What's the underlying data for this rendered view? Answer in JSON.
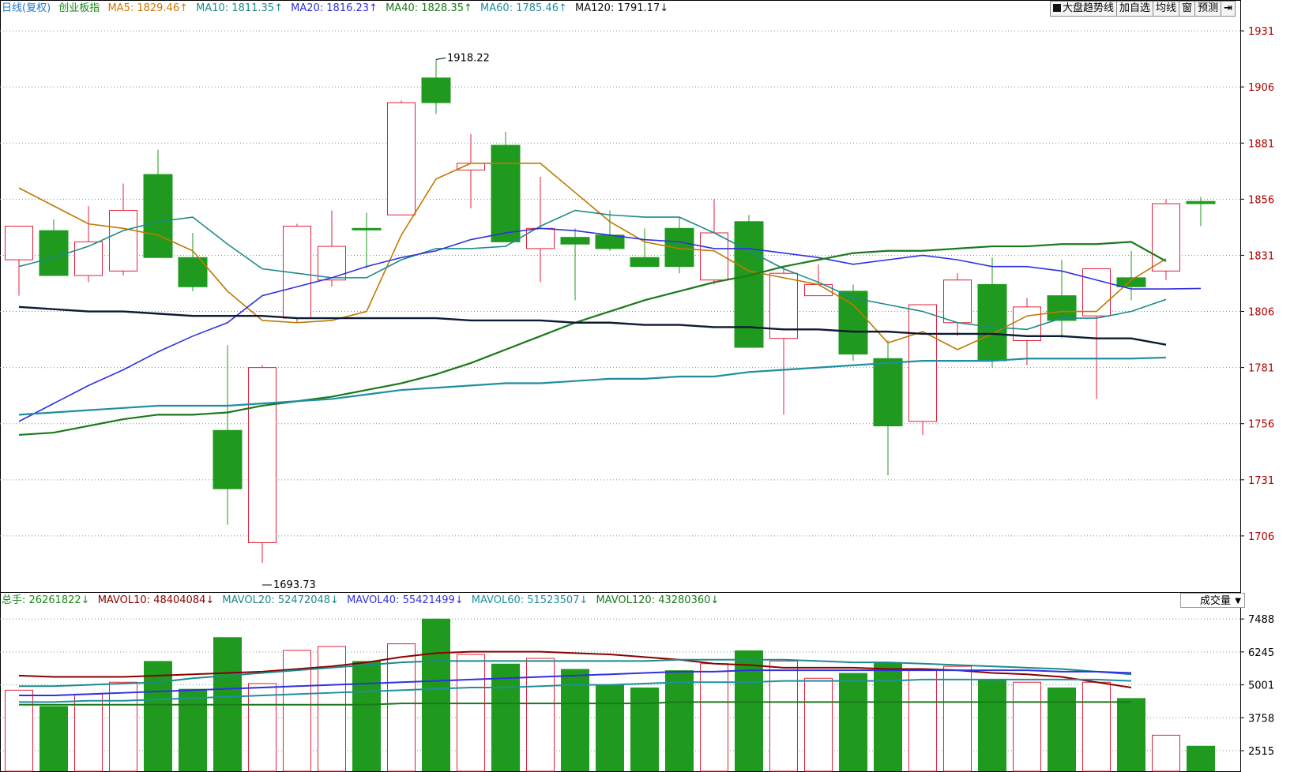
{
  "header": {
    "period_label": "日线(复权)",
    "index_name": "创业板指",
    "ma_values": [
      {
        "label": "MA5: 1829.46↑",
        "color": "#d17600"
      },
      {
        "label": "MA10: 1811.35↑",
        "color": "#1e8a8a"
      },
      {
        "label": "MA20: 1816.23↑",
        "color": "#3030e0"
      },
      {
        "label": "MA40: 1828.35↑",
        "color": "#1a7a1a"
      },
      {
        "label": "MA60: 1785.46↑",
        "color": "#1e8fa0"
      },
      {
        "label": "MA120: 1791.17↓",
        "color": "#111111"
      }
    ]
  },
  "toolbar": {
    "trend_label": "大盘趋势线",
    "add_fav_label": "加自选",
    "avg_line_label": "均线",
    "window_label": "窗",
    "forecast_label": "预测",
    "exit_icon": "exit-arrow-icon"
  },
  "volume_header": {
    "total_label": "总手: 26261822↓",
    "items": [
      {
        "label": "MAVOL10: 48404084↓",
        "color": "#8b0000"
      },
      {
        "label": "MAVOL20: 52472048↓",
        "color": "#1e8a8a"
      },
      {
        "label": "MAVOL40: 55421499↓",
        "color": "#3030e0"
      },
      {
        "label": "MAVOL60: 51523507↓",
        "color": "#1e8fa0"
      },
      {
        "label": "MAVOL120: 43280360↓",
        "color": "#1a7a1a"
      }
    ],
    "selector_value": "成交量"
  },
  "colors": {
    "up": "#e0203a",
    "down": "#1f9a1f",
    "grid": "#5aa0a0",
    "axis_text": "#b00000"
  },
  "chart_data": [
    {
      "type": "candlestick",
      "price_range": [
        1681,
        1937
      ],
      "y_ticks": [
        1931,
        1906,
        1881,
        1856,
        1831,
        1806,
        1781,
        1756,
        1731,
        1706
      ],
      "annotations": [
        {
          "text": "1918.22",
          "index": 12
        },
        {
          "text": "1693.73",
          "index": 7
        }
      ],
      "candles": [
        {
          "o": 1829,
          "h": 1836,
          "l": 1813,
          "c": 1844,
          "up": true
        },
        {
          "o": 1842,
          "h": 1847,
          "l": 1823,
          "c": 1822,
          "up": false
        },
        {
          "o": 1822,
          "h": 1853,
          "l": 1819,
          "c": 1837,
          "up": true
        },
        {
          "o": 1824,
          "h": 1863,
          "l": 1822,
          "c": 1851,
          "up": true
        },
        {
          "o": 1867,
          "h": 1878,
          "l": 1830,
          "c": 1830,
          "up": false
        },
        {
          "o": 1830,
          "h": 1841,
          "l": 1815,
          "c": 1817,
          "up": false
        },
        {
          "o": 1753,
          "h": 1791,
          "l": 1711,
          "c": 1727,
          "up": false
        },
        {
          "o": 1703,
          "h": 1782,
          "l": 1694,
          "c": 1781,
          "up": true
        },
        {
          "o": 1803,
          "h": 1845,
          "l": 1801,
          "c": 1844,
          "up": true
        },
        {
          "o": 1820,
          "h": 1851,
          "l": 1817,
          "c": 1835,
          "up": true
        },
        {
          "o": 1843,
          "h": 1850,
          "l": 1825,
          "c": 1843,
          "up": false
        },
        {
          "o": 1849,
          "h": 1900,
          "l": 1849,
          "c": 1899,
          "up": true
        },
        {
          "o": 1910,
          "h": 1918.22,
          "l": 1894,
          "c": 1899,
          "up": false
        },
        {
          "o": 1869,
          "h": 1885,
          "l": 1852,
          "c": 1872,
          "up": true
        },
        {
          "o": 1880,
          "h": 1886,
          "l": 1837,
          "c": 1837,
          "up": false
        },
        {
          "o": 1834,
          "h": 1866,
          "l": 1819,
          "c": 1843,
          "up": true
        },
        {
          "o": 1839,
          "h": 1843,
          "l": 1811,
          "c": 1836,
          "up": false
        },
        {
          "o": 1840,
          "h": 1851,
          "l": 1833,
          "c": 1834,
          "up": false
        },
        {
          "o": 1830,
          "h": 1843,
          "l": 1826,
          "c": 1826,
          "up": false
        },
        {
          "o": 1843,
          "h": 1848,
          "l": 1823,
          "c": 1826,
          "up": false
        },
        {
          "o": 1820,
          "h": 1856,
          "l": 1818,
          "c": 1841,
          "up": true
        },
        {
          "o": 1846,
          "h": 1849,
          "l": 1790,
          "c": 1790,
          "up": false
        },
        {
          "o": 1794,
          "h": 1826,
          "l": 1760,
          "c": 1823,
          "up": true
        },
        {
          "o": 1813,
          "h": 1827,
          "l": 1814,
          "c": 1818,
          "up": true
        },
        {
          "o": 1815,
          "h": 1818,
          "l": 1784,
          "c": 1787,
          "up": false
        },
        {
          "o": 1785,
          "h": 1793,
          "l": 1733,
          "c": 1755,
          "up": false
        },
        {
          "o": 1757,
          "h": 1809,
          "l": 1751,
          "c": 1809,
          "up": true
        },
        {
          "o": 1801,
          "h": 1823,
          "l": 1795,
          "c": 1820,
          "up": true
        },
        {
          "o": 1818,
          "h": 1830,
          "l": 1781,
          "c": 1784,
          "up": false
        },
        {
          "o": 1793,
          "h": 1812,
          "l": 1782,
          "c": 1808,
          "up": true
        },
        {
          "o": 1813,
          "h": 1829,
          "l": 1794,
          "c": 1802,
          "up": false
        },
        {
          "o": 1804,
          "h": 1823,
          "l": 1767,
          "c": 1825,
          "up": true
        },
        {
          "o": 1821,
          "h": 1833,
          "l": 1811,
          "c": 1817,
          "up": false
        },
        {
          "o": 1824,
          "h": 1856,
          "l": 1820,
          "c": 1854,
          "up": true
        },
        {
          "o": 1854,
          "h": 1857,
          "l": 1844,
          "c": 1855,
          "up": false
        }
      ],
      "moving_averages": [
        {
          "name": "MA5",
          "color": "#c07800",
          "width": 1.6,
          "values": [
            1861,
            1853,
            1845,
            1843,
            1840,
            1833,
            1815,
            1802,
            1801,
            1802,
            1806,
            1840,
            1865,
            1872,
            1872,
            1872,
            1859,
            1846,
            1837,
            1834,
            1833,
            1824,
            1821,
            1818,
            1809,
            1792,
            1797,
            1789,
            1796,
            1804,
            1806,
            1806,
            1820,
            1829.46
          ]
        },
        {
          "name": "MA10",
          "color": "#1e8a8a",
          "width": 1.6,
          "values": [
            1826,
            1830,
            1835,
            1842,
            1846,
            1848,
            1836,
            1825,
            1823,
            1821,
            1821,
            1829,
            1834,
            1834,
            1835,
            1844,
            1851,
            1849,
            1848,
            1848,
            1841,
            1833,
            1825,
            1819,
            1812,
            1809,
            1806,
            1801,
            1799,
            1798,
            1803,
            1803,
            1806,
            1811.35
          ]
        },
        {
          "name": "MA20",
          "color": "#3030e0",
          "width": 1.6,
          "values": [
            1757,
            1765,
            1773,
            1780,
            1788,
            1795,
            1801,
            1813,
            1817,
            1821,
            1826,
            1830,
            1833,
            1838,
            1841,
            1843,
            1842,
            1840,
            1838,
            1837,
            1834,
            1834,
            1832,
            1830,
            1827,
            1829,
            1831,
            1829,
            1826,
            1826,
            1824,
            1820,
            1816,
            1816,
            1816.23
          ]
        },
        {
          "name": "MA40",
          "color": "#1a7a1a",
          "width": 2.2,
          "values": [
            1751,
            1752,
            1755,
            1758,
            1760,
            1760,
            1761,
            1764,
            1766,
            1768,
            1771,
            1774,
            1778,
            1783,
            1789,
            1795,
            1801,
            1806,
            1811,
            1815,
            1819,
            1822,
            1826,
            1829,
            1832,
            1833,
            1833,
            1834,
            1835,
            1835,
            1836,
            1836,
            1837,
            1828.35
          ]
        },
        {
          "name": "MA60",
          "color": "#1e8fa0",
          "width": 2.2,
          "values": [
            1760,
            1761,
            1762,
            1763,
            1764,
            1764,
            1764,
            1765,
            1766,
            1767,
            1769,
            1771,
            1772,
            1773,
            1774,
            1774,
            1775,
            1776,
            1776,
            1777,
            1777,
            1779,
            1780,
            1781,
            1782,
            1783,
            1784,
            1784,
            1784,
            1785,
            1785,
            1785,
            1785,
            1785.46
          ]
        },
        {
          "name": "MA120",
          "color": "#0c1a33",
          "width": 2.4,
          "values": [
            1808,
            1807,
            1806,
            1806,
            1805,
            1804,
            1804,
            1804,
            1803,
            1803,
            1803,
            1803,
            1803,
            1802,
            1802,
            1802,
            1801,
            1801,
            1800,
            1800,
            1799,
            1799,
            1798,
            1798,
            1797,
            1797,
            1796,
            1796,
            1796,
            1795,
            1795,
            1794,
            1794,
            1791.17
          ]
        }
      ]
    },
    {
      "type": "bar",
      "title": "成交量",
      "y_ticks": [
        7488,
        6245,
        5001,
        3758,
        2515
      ],
      "y_range": [
        1740,
        7850
      ],
      "volumes": [
        4800,
        4200,
        4650,
        5100,
        5900,
        4850,
        6800,
        5050,
        6300,
        6450,
        5900,
        6550,
        7500,
        6150,
        5800,
        6000,
        5600,
        5000,
        4900,
        5550,
        5800,
        6300,
        5900,
        5250,
        5450,
        5850,
        5550,
        5700,
        5200,
        5100,
        4900,
        5100,
        4500,
        3100,
        2700
      ],
      "moving_averages": [
        {
          "name": "MAVOL10",
          "color": "#8b0000",
          "values": [
            5350,
            5300,
            5300,
            5300,
            5350,
            5400,
            5450,
            5500,
            5600,
            5700,
            5850,
            6050,
            6200,
            6250,
            6250,
            6250,
            6200,
            6150,
            6050,
            5950,
            5800,
            5750,
            5650,
            5650,
            5650,
            5600,
            5600,
            5550,
            5450,
            5400,
            5300,
            5100,
            4900
          ]
        },
        {
          "name": "MAVOL20",
          "color": "#1e8a8a",
          "values": [
            4950,
            4950,
            5000,
            5050,
            5100,
            5250,
            5350,
            5450,
            5550,
            5650,
            5750,
            5850,
            5900,
            5900,
            5900,
            5900,
            5900,
            5900,
            5900,
            5950,
            5950,
            5950,
            5950,
            5900,
            5850,
            5850,
            5800,
            5750,
            5700,
            5650,
            5600,
            5500,
            5400
          ]
        },
        {
          "name": "MAVOL40",
          "color": "#3030e0",
          "values": [
            4600,
            4600,
            4650,
            4700,
            4750,
            4800,
            4850,
            4900,
            4950,
            5000,
            5050,
            5100,
            5150,
            5200,
            5250,
            5300,
            5350,
            5400,
            5450,
            5500,
            5500,
            5550,
            5550,
            5550,
            5550,
            5550,
            5550,
            5550,
            5550,
            5550,
            5500,
            5500,
            5450
          ]
        },
        {
          "name": "MAVOL60",
          "color": "#1e8fa0",
          "values": [
            4350,
            4350,
            4400,
            4400,
            4450,
            4500,
            4550,
            4600,
            4650,
            4700,
            4750,
            4800,
            4850,
            4900,
            4900,
            4950,
            5000,
            5000,
            5050,
            5100,
            5100,
            5100,
            5150,
            5150,
            5150,
            5150,
            5200,
            5200,
            5200,
            5200,
            5200,
            5200,
            5150
          ]
        },
        {
          "name": "MAVOL120",
          "color": "#1a7a1a",
          "values": [
            4250,
            4250,
            4250,
            4250,
            4250,
            4250,
            4250,
            4250,
            4250,
            4250,
            4250,
            4300,
            4300,
            4300,
            4300,
            4300,
            4300,
            4300,
            4300,
            4350,
            4350,
            4350,
            4350,
            4350,
            4350,
            4350,
            4350,
            4350,
            4350,
            4350,
            4350,
            4350,
            4350
          ]
        }
      ]
    }
  ]
}
